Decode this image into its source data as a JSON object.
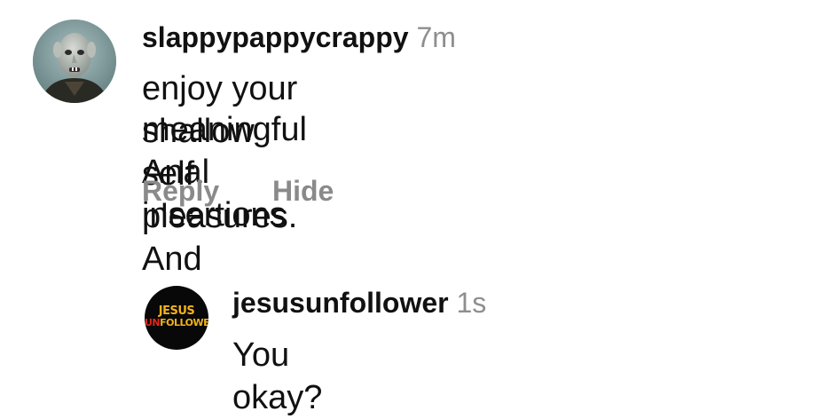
{
  "comment": {
    "username": "slappypappycrappy",
    "time": "7m",
    "text_line1": "enjoy your shallow self pleasures. And",
    "text_line2": "meaningful Anal insertions",
    "actions": {
      "reply_label": "Reply",
      "hide_label": "Hide"
    }
  },
  "reply": {
    "username": "jesusunfollower",
    "time": "1s",
    "text": "You okay?",
    "avatar_logo": {
      "line1": "JESUS",
      "line2_prefix": "UN",
      "line2_rest": "FOLLOWER",
      "colors": {
        "line1": "#f2b21b",
        "prefix": "#e0261b",
        "rest": "#f2b21b"
      }
    }
  },
  "colors": {
    "text": "#111111",
    "muted": "#8e8e8e",
    "action": "#8a8a8a",
    "background": "#ffffff"
  }
}
